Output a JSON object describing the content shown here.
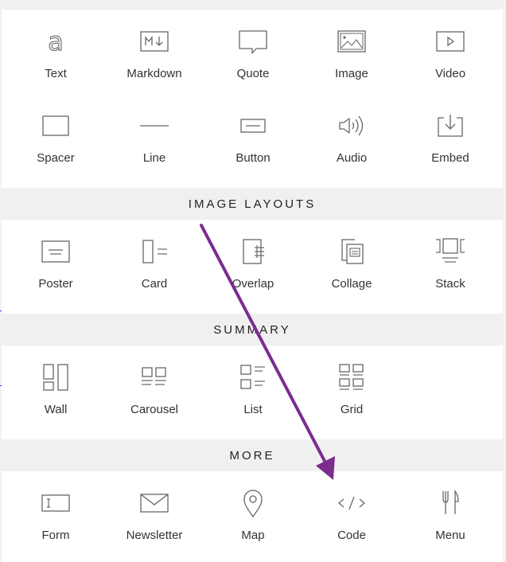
{
  "sections": [
    {
      "id": "basic",
      "title": "",
      "blocks": [
        {
          "label": "Text",
          "icon": "text-icon"
        },
        {
          "label": "Markdown",
          "icon": "markdown-icon"
        },
        {
          "label": "Quote",
          "icon": "quote-icon"
        },
        {
          "label": "Image",
          "icon": "image-icon"
        },
        {
          "label": "Video",
          "icon": "video-icon"
        },
        {
          "label": "Spacer",
          "icon": "spacer-icon"
        },
        {
          "label": "Line",
          "icon": "line-icon"
        },
        {
          "label": "Button",
          "icon": "button-icon"
        },
        {
          "label": "Audio",
          "icon": "audio-icon"
        },
        {
          "label": "Embed",
          "icon": "embed-icon"
        }
      ]
    },
    {
      "id": "image_layouts",
      "title": "IMAGE LAYOUTS",
      "blocks": [
        {
          "label": "Poster",
          "icon": "poster-icon"
        },
        {
          "label": "Card",
          "icon": "card-icon"
        },
        {
          "label": "Overlap",
          "icon": "overlap-icon"
        },
        {
          "label": "Collage",
          "icon": "collage-icon"
        },
        {
          "label": "Stack",
          "icon": "stack-icon"
        }
      ]
    },
    {
      "id": "summary",
      "title": "SUMMARY",
      "blocks": [
        {
          "label": "Wall",
          "icon": "wall-icon"
        },
        {
          "label": "Carousel",
          "icon": "carousel-icon"
        },
        {
          "label": "List",
          "icon": "list-icon"
        },
        {
          "label": "Grid",
          "icon": "grid-icon"
        }
      ]
    },
    {
      "id": "more",
      "title": "MORE",
      "blocks": [
        {
          "label": "Form",
          "icon": "form-icon"
        },
        {
          "label": "Newsletter",
          "icon": "newsletter-icon"
        },
        {
          "label": "Map",
          "icon": "map-pin-icon"
        },
        {
          "label": "Code",
          "icon": "code-icon"
        },
        {
          "label": "Menu",
          "icon": "menu-fork-knife-icon"
        }
      ]
    }
  ],
  "annotation": {
    "type": "arrow",
    "color": "#7b2d8e",
    "from_block": "Card",
    "to_block": "Code"
  }
}
